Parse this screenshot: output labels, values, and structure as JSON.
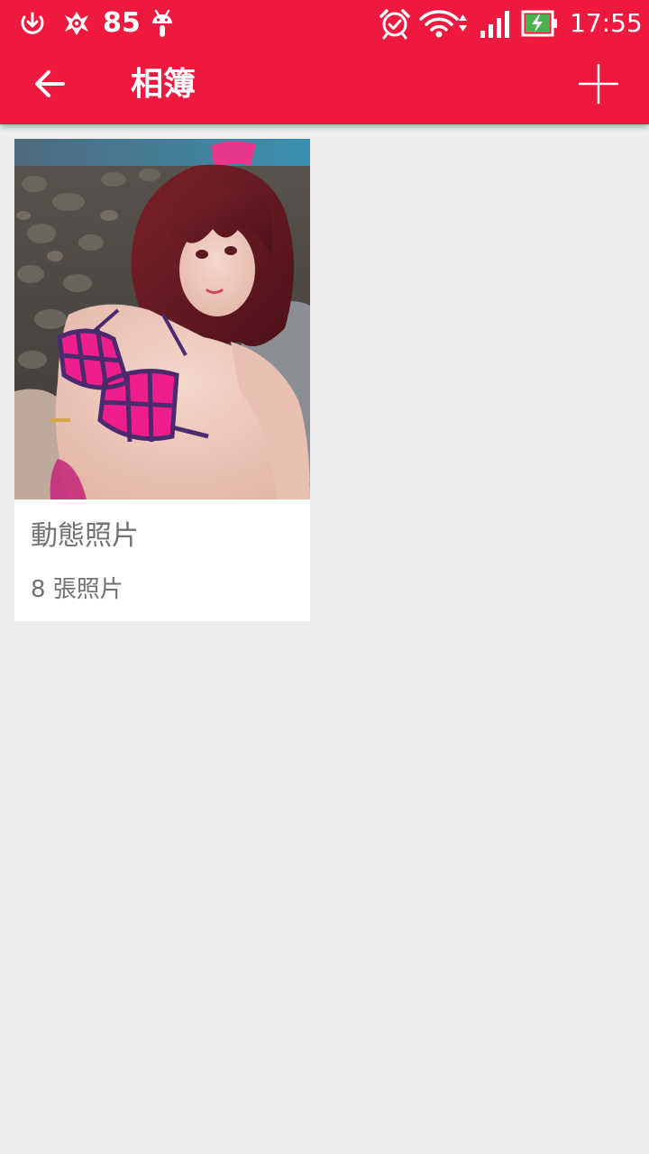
{
  "status_bar": {
    "icons_left": [
      "download-circle-icon",
      "bug-logo-icon",
      "android-robot-icon"
    ],
    "notification_count": "85",
    "icons_right": [
      "alarm-icon",
      "wifi-icon",
      "signal-icon",
      "battery-charging-icon"
    ],
    "time": "17:55"
  },
  "app_bar": {
    "back_icon": "arrow-left-icon",
    "title": "相簿",
    "add_icon": "plus-icon"
  },
  "albums": [
    {
      "name": "動態照片",
      "count_label": "8 張照片",
      "cover": "cosplay-portrait-photo"
    }
  ],
  "colors": {
    "primary": "#ef193f",
    "background": "#eeeeee",
    "card": "#ffffff",
    "secondary_text": "#727272"
  }
}
